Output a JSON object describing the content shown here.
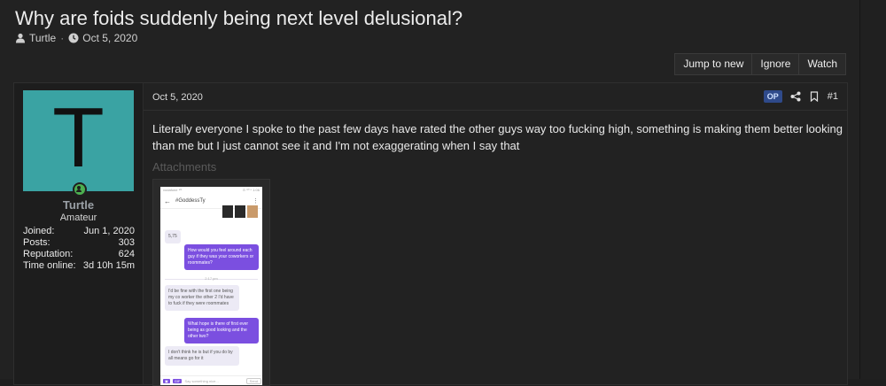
{
  "thread": {
    "title": "Why are foids suddenly being next level delusional?",
    "starter": "Turtle",
    "date": "Oct 5, 2020"
  },
  "actions": {
    "jump_to_new": "Jump to new",
    "ignore": "Ignore",
    "watch": "Watch"
  },
  "post": {
    "date": "Oct 5, 2020",
    "op_badge": "OP",
    "number": "#1",
    "body": "Literally everyone I spoke to the past few days have rated the other guys way too fucking high, something is making them better looking than me but I just cannot see it and I'm not exaggerating when I say that",
    "attachments_label": "Attachments"
  },
  "author": {
    "avatar_letter": "T",
    "avatar_color": "#3aa3a3",
    "name": "Turtle",
    "title": "Amateur",
    "stats": [
      {
        "label": "Joined:",
        "value": "Jun 1, 2020"
      },
      {
        "label": "Posts:",
        "value": "303"
      },
      {
        "label": "Reputation:",
        "value": "624"
      },
      {
        "label": "Time online:",
        "value": "3d 10h 15m"
      }
    ]
  },
  "attachment_screenshot": {
    "status_left": "vodafone ⁴ᴳ",
    "status_right": "⊙ ⁸⁰ ⁿ 1:06",
    "chat_title": "#GoddessTy",
    "score": "5,75",
    "msg1": "How would you feel around each guy if they was your coworkers or roommates?",
    "time": "2:17 pm",
    "msg2": "I'd be fine with the first one being my co worker the other 2 I'd have to fuck if they were roommates",
    "msg3": "What hope is there of first ever being as good looking and the other two?",
    "msg4": "I don't think he is but if you do by all means go for it",
    "input_placeholder": "Say something nice...",
    "gif_label": "GIF",
    "send_label": "Send"
  }
}
